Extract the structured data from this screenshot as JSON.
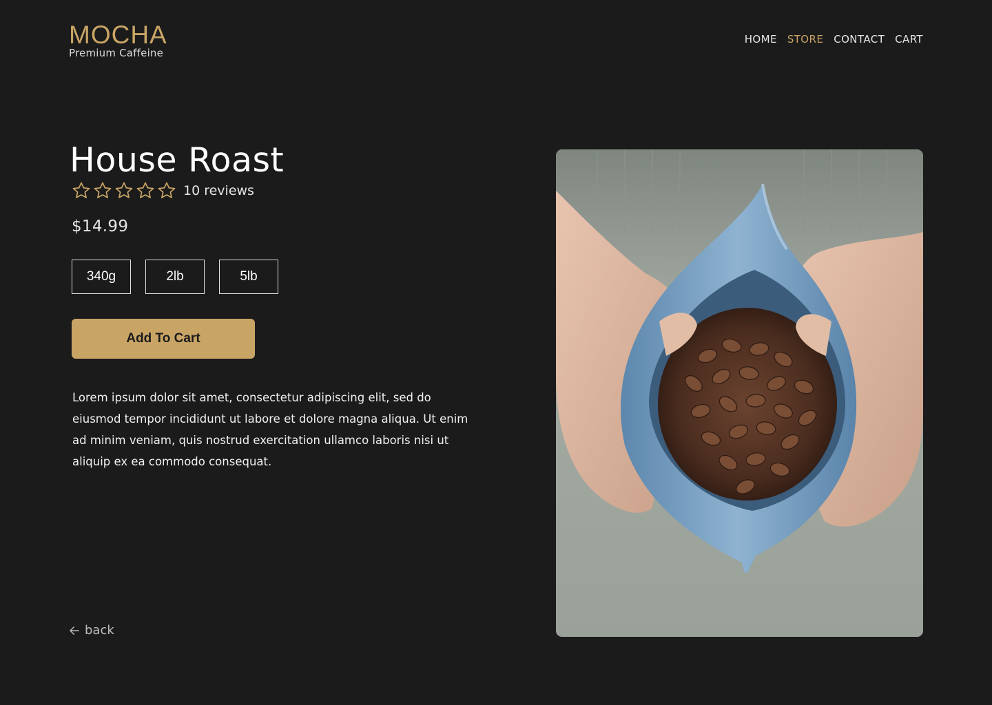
{
  "brand": {
    "name": "MOCHA",
    "tagline": "Premium Caffeine",
    "accent_color": "#c9a565"
  },
  "nav": {
    "items": [
      {
        "label": "HOME",
        "active": false
      },
      {
        "label": "STORE",
        "active": true
      },
      {
        "label": "CONTACT",
        "active": false
      },
      {
        "label": "CART",
        "active": false
      }
    ]
  },
  "product": {
    "title": "House Roast",
    "rating": {
      "stars_filled": 0,
      "stars_total": 5,
      "reviews_label": "10 reviews"
    },
    "price": "$14.99",
    "sizes": [
      "340g",
      "2lb",
      "5lb"
    ],
    "add_to_cart_label": "Add To Cart",
    "description": "Lorem ipsum dolor sit amet, consectetur adipiscing elit, sed do eiusmod tempor incididunt ut labore et dolore magna aliqua. Ut enim ad minim veniam, quis nostrud exercitation ullamco laboris nisi ut aliquip ex ea commodo consequat.",
    "image_icon": "coffee-bag-photo"
  },
  "back": {
    "label": "back",
    "icon": "arrow-left-icon"
  },
  "colors": {
    "background": "#1b1b1b",
    "accent": "#c9a565",
    "text": "#ffffff"
  }
}
